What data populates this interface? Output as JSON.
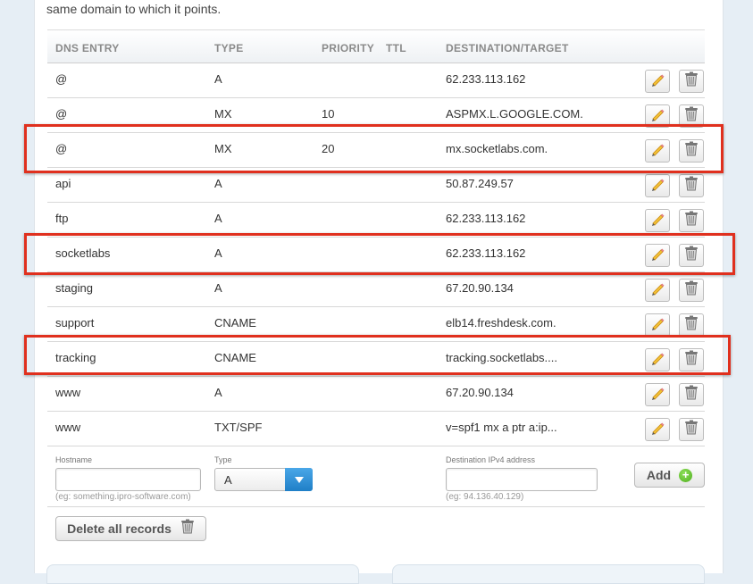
{
  "intro_text": "same domain to which it points.",
  "table": {
    "headers": {
      "entry": "DNS ENTRY",
      "type": "TYPE",
      "priority": "PRIORITY",
      "ttl": "TTL",
      "destination": "DESTINATION/TARGET"
    },
    "rows": [
      {
        "entry": "@",
        "type": "A",
        "priority": "",
        "destination": "62.233.113.162"
      },
      {
        "entry": "@",
        "type": "MX",
        "priority": "10",
        "destination": "ASPMX.L.GOOGLE.COM."
      },
      {
        "entry": "@",
        "type": "MX",
        "priority": "20",
        "destination": "mx.socketlabs.com."
      },
      {
        "entry": "api",
        "type": "A",
        "priority": "",
        "destination": "50.87.249.57"
      },
      {
        "entry": "ftp",
        "type": "A",
        "priority": "",
        "destination": "62.233.113.162"
      },
      {
        "entry": "socketlabs",
        "type": "A",
        "priority": "",
        "destination": "62.233.113.162"
      },
      {
        "entry": "staging",
        "type": "A",
        "priority": "",
        "destination": "67.20.90.134"
      },
      {
        "entry": "support",
        "type": "CNAME",
        "priority": "",
        "destination": "elb14.freshdesk.com."
      },
      {
        "entry": "tracking",
        "type": "CNAME",
        "priority": "",
        "destination": "tracking.socketlabs...."
      },
      {
        "entry": "www",
        "type": "A",
        "priority": "",
        "destination": "67.20.90.134"
      },
      {
        "entry": "www",
        "type": "TXT/SPF",
        "priority": "",
        "destination": "v=spf1 mx a ptr a:ip..."
      }
    ]
  },
  "add_form": {
    "hostname_label": "Hostname",
    "hostname_value": "",
    "hostname_hint": "(eg: something.ipro-software.com)",
    "type_label": "Type",
    "type_value": "A",
    "destination_label": "Destination IPv4 address",
    "destination_value": "",
    "destination_hint": "(eg: 94.136.40.129)",
    "add_label": "Add"
  },
  "delete_all_label": "Delete all records",
  "icons": {
    "edit": "pencil-icon",
    "delete": "trash-icon",
    "add": "plus-circle-icon",
    "dropdown": "chevron-down-icon"
  },
  "colors": {
    "highlight": "#e0301e",
    "accent": "#1f7fc7",
    "add_green": "#4fae1e"
  },
  "highlighted_rows": [
    "@ MX 20",
    "socketlabs",
    "tracking"
  ]
}
